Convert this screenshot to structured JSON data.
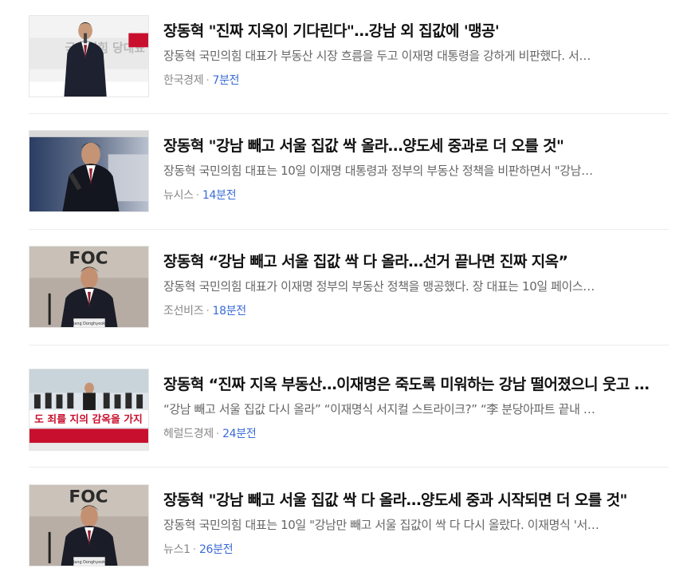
{
  "articles": [
    {
      "title": "장동혁 \"진짜 지옥이 기다린다\"…강남 외 집값에 '맹공'",
      "summary": "장동혁 국민의힘 대표가 부동산 시장 흐름을 두고 이재명 대통령을 강하게 비판했다. 서…",
      "press": "한국경제",
      "time": "7분전",
      "thumb_banner": "국민의힘 당대표"
    },
    {
      "title": "장동혁 \"강남 빼고 서울 집값 싹 올라…양도세 중과로 더 오를 것\"",
      "summary": "장동혁 국민의힘 대표는 10일 이재명 대통령과 정부의 부동산 정책을 비판하면서 \"강남…",
      "press": "뉴시스",
      "time": "14분전"
    },
    {
      "title": "장동혁 “강남 빼고 서울 집값 싹 다 올라…선거 끝나면 진짜 지옥”",
      "summary": "장동혁 국민의힘 대표가 이재명 정부의 부동산 정책을 맹공했다. 장 대표는 10일 페이스…",
      "press": "조선비즈",
      "time": "18분전",
      "thumb_backdrop": "FOC",
      "thumb_nameplate": "Jang Donghyeok"
    },
    {
      "title": "장동혁 “진짜 지옥 부동산…이재명은 죽도록 미워하는 강남 떨어졌으니 웃고 …",
      "summary": "“강남 빼고 서울 집값 다시 올라” “이재명식 서지컬 스트라이크?” “李 분당아파트 끝내 …",
      "press": "헤럴드경제",
      "time": "24분전",
      "thumb_banner": "도 죄를 지의 감옥을 가지"
    },
    {
      "title": "장동혁 \"강남 빼고 서울 집값 싹 다 올라…양도세 중과 시작되면 더 오를 것\"",
      "summary": "장동혁 국민의힘 대표는 10일 \"강남만 빼고 서울 집값이 싹 다 다시 올랐다. 이재명식 '서…",
      "press": "뉴스1",
      "time": "26분전",
      "thumb_backdrop": "FOC",
      "thumb_nameplate": "Jang Donghyeok"
    }
  ],
  "colors": {
    "title": "#111111",
    "summary": "#666666",
    "press": "#888888",
    "time": "#3a6bd6",
    "divider": "#ececec"
  }
}
